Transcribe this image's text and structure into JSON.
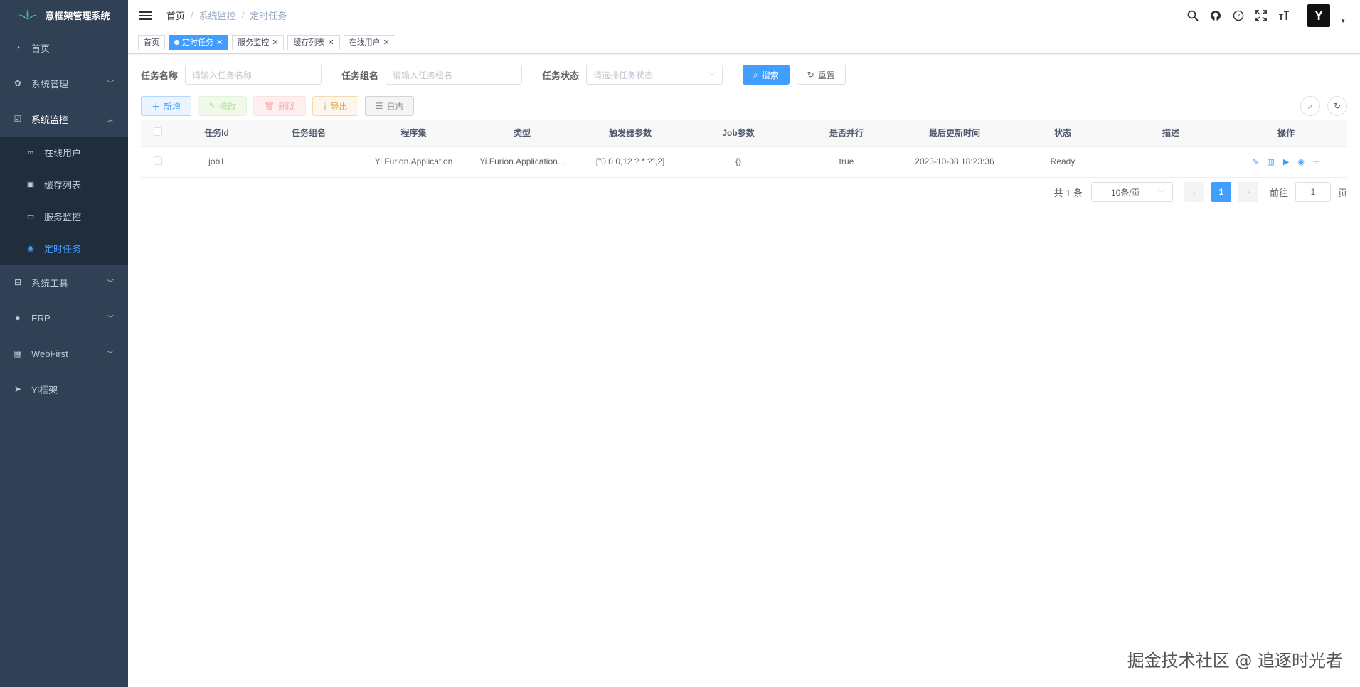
{
  "app": {
    "title": "意框架管理系统"
  },
  "sidebar": {
    "items": [
      {
        "label": "首页",
        "icon": "dashboard-icon"
      },
      {
        "label": "系统管理",
        "icon": "gear-icon"
      },
      {
        "label": "系统监控",
        "icon": "monitor-icon"
      },
      {
        "label": "系统工具",
        "icon": "toolbox-icon"
      },
      {
        "label": "ERP",
        "icon": "globe-icon"
      },
      {
        "label": "WebFirst",
        "icon": "table-icon"
      },
      {
        "label": "Yi框架",
        "icon": "send-icon"
      }
    ],
    "submenu": [
      {
        "label": "在线用户",
        "icon": "link-icon"
      },
      {
        "label": "缓存列表",
        "icon": "cache-icon"
      },
      {
        "label": "服务监控",
        "icon": "server-icon"
      },
      {
        "label": "定时任务",
        "icon": "timer-icon"
      }
    ]
  },
  "breadcrumb": [
    "首页",
    "系统监控",
    "定时任务"
  ],
  "tags": [
    {
      "label": "首页"
    },
    {
      "label": "定时任务"
    },
    {
      "label": "服务监控"
    },
    {
      "label": "缓存列表"
    },
    {
      "label": "在线用户"
    }
  ],
  "search": {
    "task_name_label": "任务名称",
    "task_name_placeholder": "请输入任务名称",
    "task_group_label": "任务组名",
    "task_group_placeholder": "请输入任务组名",
    "task_status_label": "任务状态",
    "task_status_placeholder": "请选择任务状态",
    "search_button": "搜索",
    "reset_button": "重置"
  },
  "toolbar": {
    "add": "新增",
    "edit": "修改",
    "delete": "删除",
    "export": "导出",
    "log": "日志"
  },
  "table": {
    "columns": [
      "任务Id",
      "任务组名",
      "程序集",
      "类型",
      "触发器参数",
      "Job参数",
      "是否并行",
      "最后更新时间",
      "状态",
      "描述",
      "操作"
    ],
    "rows": [
      {
        "id": "job1",
        "group": "",
        "assembly": "Yi.Furion.Application",
        "type": "Yi.Furion.Application...",
        "trigger": "[\"0 0 0,12 ? * ?\",2]",
        "job_params": "{}",
        "parallel": "true",
        "updated": "2023-10-08 18:23:36",
        "status": "Ready",
        "desc": ""
      }
    ]
  },
  "pagination": {
    "total": "共 1 条",
    "page_size": "10条/页",
    "current": "1",
    "goto_label": "前往",
    "goto_value": "1",
    "page_suffix": "页"
  },
  "watermark": "掘金技术社区 @ 追逐时光者",
  "colors": {
    "primary": "#409eff",
    "sidebar": "#304156",
    "submenu": "#1f2d3d"
  }
}
